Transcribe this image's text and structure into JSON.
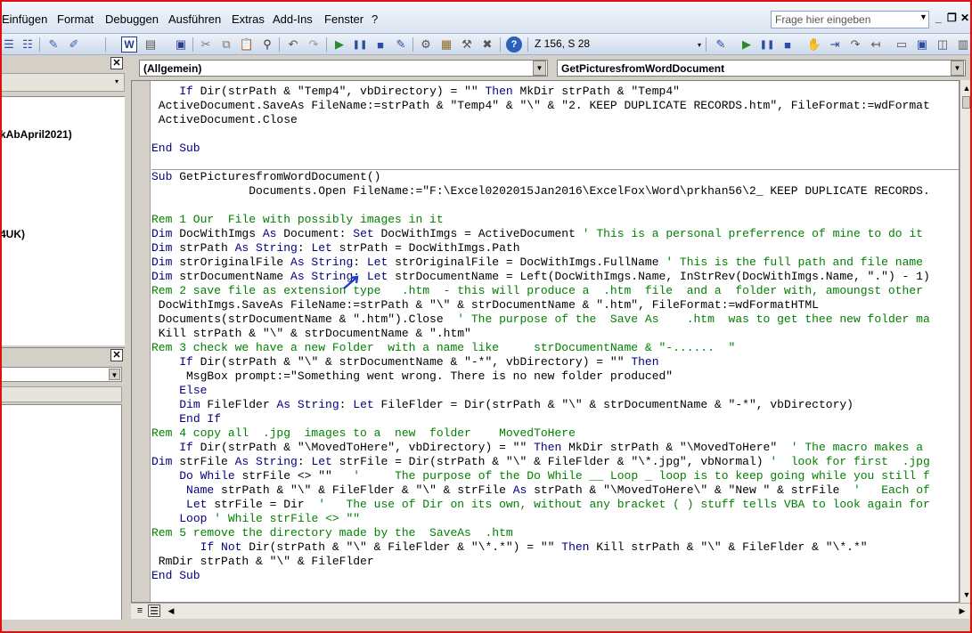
{
  "menu": {
    "items": [
      "Einfügen",
      "Format",
      "Debuggen",
      "Ausführen",
      "Extras",
      "Add-Ins",
      "Fenster",
      "?"
    ]
  },
  "help_search": {
    "placeholder": "Frage hier eingeben"
  },
  "toolbar": {
    "cursor_position": "Z 156, S 28"
  },
  "project_tree": {
    "items": [
      "kAbApril2021)",
      "4UK)"
    ]
  },
  "code_window": {
    "object_combo": "(Allgemein)",
    "procedure_combo": "GetPicturesfromWordDocument"
  },
  "code_lines": [
    [
      [
        "    ",
        ""
      ],
      [
        "If",
        "kw"
      ],
      [
        " Dir(strPath & \"Temp4\", vbDirectory) = \"\" ",
        ""
      ],
      [
        "Then",
        "kw"
      ],
      [
        " MkDir strPath & \"Temp4\"",
        ""
      ]
    ],
    [
      [
        " ActiveDocument.SaveAs FileName:=strPath & \"Temp4\" & \"\\\" & \"2. KEEP DUPLICATE RECORDS.htm\", FileFormat:=wdFormat",
        ""
      ]
    ],
    [
      [
        " ActiveDocument.Close",
        ""
      ]
    ],
    [
      [
        "",
        ""
      ]
    ],
    [
      [
        "",
        ""
      ],
      [
        "End Sub",
        "kw"
      ]
    ],
    [
      [
        "",
        ""
      ]
    ],
    [
      [
        "",
        ""
      ],
      [
        "Sub",
        "kw"
      ],
      [
        " GetPicturesfromWordDocument()",
        ""
      ]
    ],
    [
      [
        "              Documents.Open FileName:=\"F:\\Excel0202015Jan2016\\ExcelFox\\Word\\prkhan56\\2_ KEEP DUPLICATE RECORDS.",
        ""
      ]
    ],
    [
      [
        "",
        ""
      ]
    ],
    [
      [
        "",
        ""
      ],
      [
        "Rem 1 Our  File with possibly images in it",
        "cm"
      ]
    ],
    [
      [
        "",
        ""
      ],
      [
        "Dim",
        "kw"
      ],
      [
        " DocWithImgs ",
        ""
      ],
      [
        "As",
        "kw"
      ],
      [
        " Document: ",
        ""
      ],
      [
        "Set",
        "kw"
      ],
      [
        " DocWithImgs = ActiveDocument ",
        ""
      ],
      [
        "' This is a personal preferrence of mine to do it",
        "cm"
      ]
    ],
    [
      [
        "",
        ""
      ],
      [
        "Dim",
        "kw"
      ],
      [
        " strPath ",
        ""
      ],
      [
        "As String",
        "kw"
      ],
      [
        ": ",
        ""
      ],
      [
        "Let",
        "kw"
      ],
      [
        " strPath = DocWithImgs.Path",
        ""
      ]
    ],
    [
      [
        "",
        ""
      ],
      [
        "Dim",
        "kw"
      ],
      [
        " strOriginalFile ",
        ""
      ],
      [
        "As String",
        "kw"
      ],
      [
        ": ",
        ""
      ],
      [
        "Let",
        "kw"
      ],
      [
        " strOriginalFile = DocWithImgs.FullName ",
        ""
      ],
      [
        "' This is the full path and file name",
        "cm"
      ]
    ],
    [
      [
        "",
        ""
      ],
      [
        "Dim",
        "kw"
      ],
      [
        " strDocumentName ",
        ""
      ],
      [
        "As String",
        "kw"
      ],
      [
        ": ",
        ""
      ],
      [
        "Let",
        "kw"
      ],
      [
        " strDocumentName = Left(DocWithImgs.Name, InStrRev(DocWithImgs.Name, \".\") - 1)",
        ""
      ]
    ],
    [
      [
        "",
        ""
      ],
      [
        "Rem 2 save file as extension type   .htm  - this will produce a  .htm  file  and a  folder with, amoungst other",
        "cm"
      ]
    ],
    [
      [
        " DocWithImgs.SaveAs FileName:=strPath & \"\\\" & strDocumentName & \".htm\", FileFormat:=wdFormatHTML",
        ""
      ]
    ],
    [
      [
        " Documents(strDocumentName & \".htm\").Close  ",
        ""
      ],
      [
        "' The purpose of the  Save As    .htm  was to get thee new folder ma",
        "cm"
      ]
    ],
    [
      [
        " Kill strPath & \"\\\" & strDocumentName & \".htm\"",
        ""
      ]
    ],
    [
      [
        "",
        ""
      ],
      [
        "Rem 3 check we have a new Folder  with a name like     strDocumentName & \"-......  \"",
        "cm"
      ]
    ],
    [
      [
        "    ",
        ""
      ],
      [
        "If",
        "kw"
      ],
      [
        " Dir(strPath & \"\\\" & strDocumentName & \"-*\", vbDirectory) = \"\" ",
        ""
      ],
      [
        "Then",
        "kw"
      ]
    ],
    [
      [
        "     MsgBox prompt:=\"Something went wrong. There is no new folder produced\"",
        ""
      ]
    ],
    [
      [
        "    ",
        ""
      ],
      [
        "Else",
        "kw"
      ]
    ],
    [
      [
        "    ",
        ""
      ],
      [
        "Dim",
        "kw"
      ],
      [
        " FileFlder ",
        ""
      ],
      [
        "As String",
        "kw"
      ],
      [
        ": ",
        ""
      ],
      [
        "Let",
        "kw"
      ],
      [
        " FileFlder = Dir(strPath & \"\\\" & strDocumentName & \"-*\", vbDirectory)",
        ""
      ]
    ],
    [
      [
        "    ",
        ""
      ],
      [
        "End If",
        "kw"
      ]
    ],
    [
      [
        "",
        ""
      ],
      [
        "Rem 4 copy all  .jpg  images to a  new  folder    MovedToHere",
        "cm"
      ]
    ],
    [
      [
        "    ",
        ""
      ],
      [
        "If",
        "kw"
      ],
      [
        " Dir(strPath & \"\\MovedToHere\", vbDirectory) = \"\" ",
        ""
      ],
      [
        "Then",
        "kw"
      ],
      [
        " MkDir strPath & \"\\MovedToHere\"  ",
        ""
      ],
      [
        "' The macro makes a",
        "cm"
      ]
    ],
    [
      [
        "",
        ""
      ],
      [
        "Dim",
        "kw"
      ],
      [
        " strFile ",
        ""
      ],
      [
        "As String",
        "kw"
      ],
      [
        ": ",
        ""
      ],
      [
        "Let",
        "kw"
      ],
      [
        " strFile = Dir(strPath & \"\\\" & FileFlder & \"\\*.jpg\", vbNormal) ",
        ""
      ],
      [
        "'  look for first  .jpg",
        "cm"
      ]
    ],
    [
      [
        "    ",
        ""
      ],
      [
        "Do While",
        "kw"
      ],
      [
        " strFile <> \"\"   ",
        ""
      ],
      [
        "'     The purpose of the Do While __ Loop _ loop is to keep going while you still f",
        "cm"
      ]
    ],
    [
      [
        "     ",
        ""
      ],
      [
        "Name",
        "kw"
      ],
      [
        " strPath & \"\\\" & FileFlder & \"\\\" & strFile ",
        ""
      ],
      [
        "As",
        "kw"
      ],
      [
        " strPath & \"\\MovedToHere\\\" & \"New \" & strFile  ",
        ""
      ],
      [
        "'   Each of",
        "cm"
      ]
    ],
    [
      [
        "     ",
        ""
      ],
      [
        "Let",
        "kw"
      ],
      [
        " strFile = Dir  ",
        ""
      ],
      [
        "'   The use of Dir on its own, without any bracket ( ) stuff tells VBA to look again for",
        "cm"
      ]
    ],
    [
      [
        "    ",
        ""
      ],
      [
        "Loop",
        "kw"
      ],
      [
        " ",
        ""
      ],
      [
        "' While strFile <> \"\"",
        "cm"
      ]
    ],
    [
      [
        "",
        ""
      ],
      [
        "Rem 5 remove the directory made by the  SaveAs  .htm",
        "cm"
      ]
    ],
    [
      [
        "       ",
        ""
      ],
      [
        "If Not",
        "kw"
      ],
      [
        " Dir(strPath & \"\\\" & FileFlder & \"\\*.*\") = \"\" ",
        ""
      ],
      [
        "Then",
        "kw"
      ],
      [
        " Kill strPath & \"\\\" & FileFlder & \"\\*.*\"",
        ""
      ]
    ],
    [
      [
        " RmDir strPath & \"\\\" & FileFlder",
        ""
      ]
    ],
    [
      [
        "",
        ""
      ],
      [
        "End Sub",
        "kw"
      ]
    ]
  ]
}
